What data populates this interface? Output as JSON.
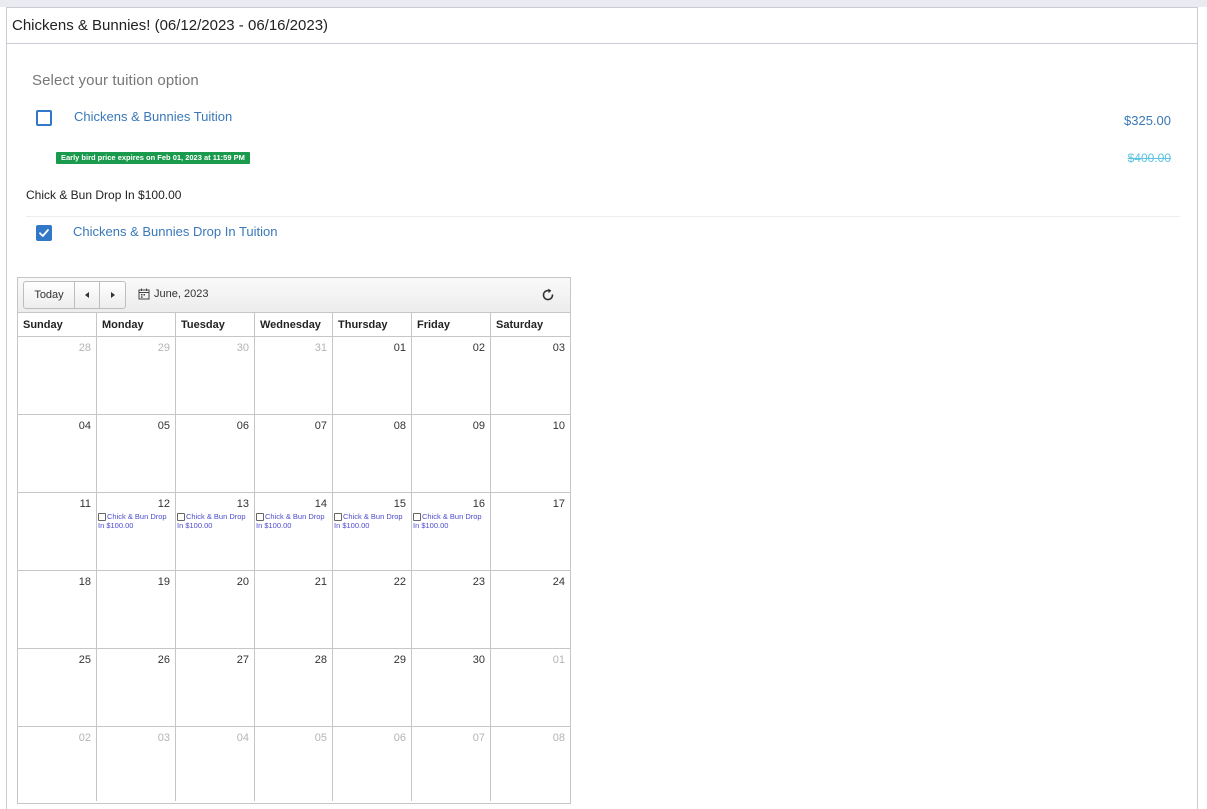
{
  "header": {
    "title": "Chickens & Bunnies! (06/12/2023 - 06/16/2023)"
  },
  "tuition": {
    "section_title": "Select your tuition option",
    "options": [
      {
        "label": "Chickens & Bunnies Tuition",
        "checked": false,
        "price": "$325.00",
        "old_price": "$400.00",
        "badge": "Early bird price expires on Feb 01, 2023 at 11:59 PM"
      },
      {
        "label": "Chickens & Bunnies Drop In Tuition",
        "checked": true
      }
    ],
    "dropin_heading": "Chick & Bun Drop In $100.00"
  },
  "calendar": {
    "today_label": "Today",
    "prev_icon": "prev-arrow-icon",
    "next_icon": "next-arrow-icon",
    "month_label": "June, 2023",
    "weekdays": [
      "Sunday",
      "Monday",
      "Tuesday",
      "Wednesday",
      "Thursday",
      "Friday",
      "Saturday"
    ],
    "weeks": [
      [
        {
          "n": "28",
          "other": true
        },
        {
          "n": "29",
          "other": true
        },
        {
          "n": "30",
          "other": true
        },
        {
          "n": "31",
          "other": true
        },
        {
          "n": "01"
        },
        {
          "n": "02"
        },
        {
          "n": "03"
        }
      ],
      [
        {
          "n": "04"
        },
        {
          "n": "05"
        },
        {
          "n": "06"
        },
        {
          "n": "07"
        },
        {
          "n": "08"
        },
        {
          "n": "09"
        },
        {
          "n": "10"
        }
      ],
      [
        {
          "n": "11"
        },
        {
          "n": "12",
          "event": "Chick & Bun Drop In $100.00"
        },
        {
          "n": "13",
          "event": "Chick & Bun Drop In $100.00"
        },
        {
          "n": "14",
          "event": "Chick & Bun Drop In $100.00"
        },
        {
          "n": "15",
          "event": "Chick & Bun Drop In $100.00"
        },
        {
          "n": "16",
          "event": "Chick & Bun Drop In $100.00"
        },
        {
          "n": "17"
        }
      ],
      [
        {
          "n": "18"
        },
        {
          "n": "19"
        },
        {
          "n": "20"
        },
        {
          "n": "21"
        },
        {
          "n": "22"
        },
        {
          "n": "23"
        },
        {
          "n": "24"
        }
      ],
      [
        {
          "n": "25"
        },
        {
          "n": "26"
        },
        {
          "n": "27"
        },
        {
          "n": "28"
        },
        {
          "n": "29"
        },
        {
          "n": "30"
        },
        {
          "n": "01",
          "other": true
        }
      ],
      [
        {
          "n": "02",
          "other": true
        },
        {
          "n": "03",
          "other": true
        },
        {
          "n": "04",
          "other": true
        },
        {
          "n": "05",
          "other": true
        },
        {
          "n": "06",
          "other": true
        },
        {
          "n": "07",
          "other": true
        },
        {
          "n": "08",
          "other": true
        }
      ]
    ]
  },
  "colors": {
    "accent": "#3a78b8",
    "badge": "#1a9a4c",
    "old_price": "#5bc3de",
    "event_text": "#4b4bd0"
  }
}
